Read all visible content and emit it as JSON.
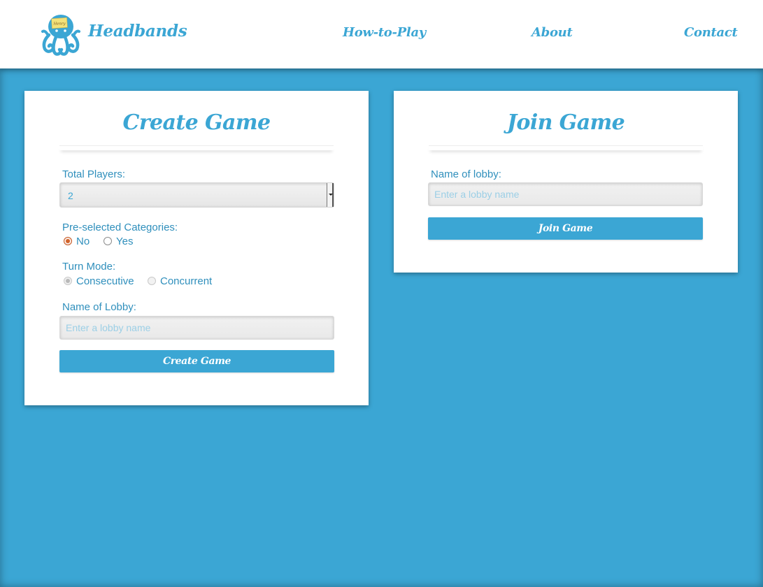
{
  "header": {
    "brand": "Headbands",
    "logo_badge": "Henry",
    "nav": [
      "How-to-Play",
      "About",
      "Contact"
    ]
  },
  "create_game": {
    "title": "Create Game",
    "total_players_label": "Total Players:",
    "total_players_value": "2",
    "categories_label": "Pre-selected Categories:",
    "categories_options": [
      "No",
      "Yes"
    ],
    "categories_selected": "No",
    "turn_mode_label": "Turn Mode:",
    "turn_mode_options": [
      "Consecutive",
      "Concurrent"
    ],
    "turn_mode_selected": "Consecutive",
    "lobby_label": "Name of Lobby:",
    "lobby_placeholder": "Enter a lobby name",
    "submit_label": "Create Game"
  },
  "join_game": {
    "title": "Join Game",
    "lobby_label": "Name of lobby:",
    "lobby_placeholder": "Enter a lobby name",
    "submit_label": "Join Game"
  },
  "colors": {
    "accent": "#3ba6d4",
    "background": "#3ba6d4",
    "card": "#ffffff",
    "radio_selected": "#d2622a"
  }
}
